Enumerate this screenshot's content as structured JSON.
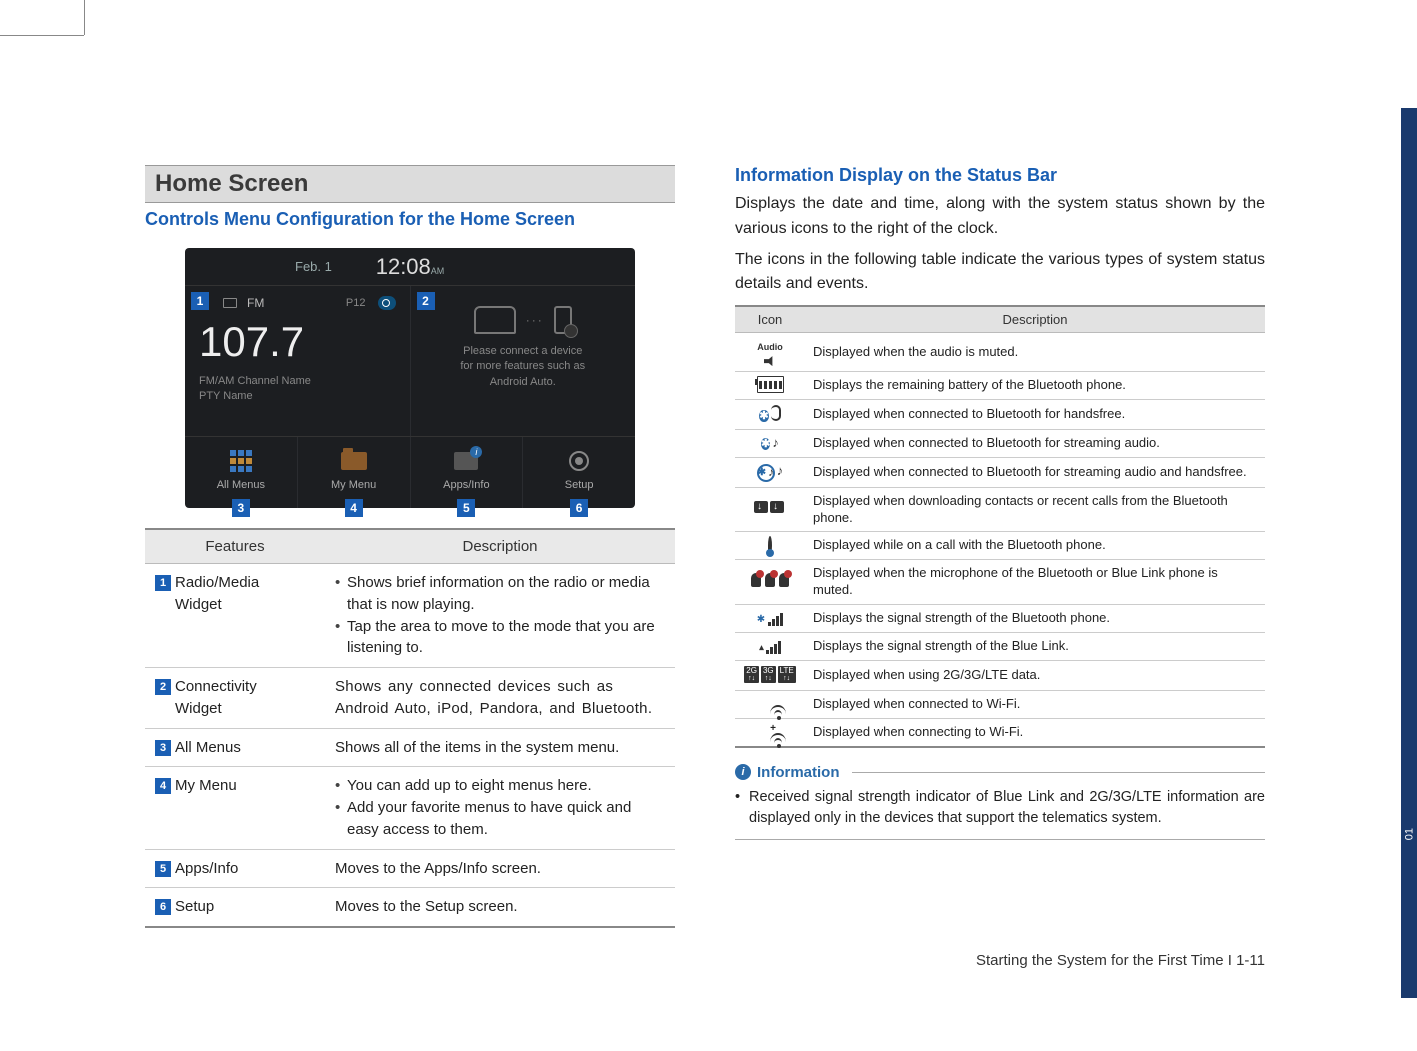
{
  "left": {
    "section_title": "Home Screen",
    "subtitle": "Controls Menu Configuration for the Home Screen",
    "device": {
      "date": "Feb.  1",
      "time": "12:08",
      "ampm": "AM",
      "fm_label": "FM",
      "preset": "P12",
      "frequency": "107.7",
      "channel_line1": "FM/AM Channel Name",
      "channel_line2": "PTY Name",
      "connect_msg_l1": "Please connect a device",
      "connect_msg_l2": "for more features such as",
      "connect_msg_l3": "Android Auto.",
      "btn1": "All Menus",
      "btn2": "My Menu",
      "btn3": "Apps/Info",
      "btn4": "Setup"
    },
    "callouts": {
      "c1": "1",
      "c2": "2",
      "c3": "3",
      "c4": "4",
      "c5": "5",
      "c6": "6"
    },
    "table": {
      "h1": "Features",
      "h2": "Description",
      "rows": [
        {
          "num": "1",
          "name": "Radio/Media Widget",
          "desc_items": [
            "Shows brief information on the radio or media that is now playing.",
            "Tap the area to move to the mode that you are listening to."
          ]
        },
        {
          "num": "2",
          "name": "Connectivity Widget",
          "desc_plain": "Shows any connected devices such as Android Auto, iPod, Pandora, and Bluetooth."
        },
        {
          "num": "3",
          "name": "All Menus",
          "desc_plain": "Shows all of the items in the system menu."
        },
        {
          "num": "4",
          "name": "My Menu",
          "desc_items": [
            "You can add up to eight menus here.",
            "Add your favorite menus to have quick and easy access to them."
          ]
        },
        {
          "num": "5",
          "name": "Apps/Info",
          "desc_plain": "Moves to the Apps/Info screen."
        },
        {
          "num": "6",
          "name": "Setup",
          "desc_plain": "Moves to the Setup screen."
        }
      ]
    }
  },
  "right": {
    "subtitle": "Information Display on the Status Bar",
    "para1": "Displays the date and time, along with the system status shown by the various icons to the right of the clock.",
    "para2": "The icons in the following table indicate the various types of system status details and events.",
    "icon_table": {
      "h1": "Icon",
      "h2": "Description",
      "rows": [
        {
          "icon": "audio-mute",
          "desc": "Displayed when the audio is muted."
        },
        {
          "icon": "battery",
          "desc": "Displays the remaining battery of the Bluetooth phone."
        },
        {
          "icon": "bt-handsfree",
          "desc": "Displayed when connected to Bluetooth for handsfree."
        },
        {
          "icon": "bt-audio",
          "desc": "Displayed when connected to Bluetooth for streaming audio."
        },
        {
          "icon": "bt-both",
          "desc": "Displayed when connected to Bluetooth for streaming audio and handsfree."
        },
        {
          "icon": "bt-download",
          "desc": "Displayed when downloading contacts or recent calls from the Bluetooth phone."
        },
        {
          "icon": "bt-call",
          "desc": "Displayed while on a call with the Bluetooth phone."
        },
        {
          "icon": "mic-mute",
          "desc": "Displayed when the microphone of the Bluetooth or Blue Link phone is muted."
        },
        {
          "icon": "bt-signal",
          "desc": "Displays the signal strength of the Bluetooth phone."
        },
        {
          "icon": "bl-signal",
          "desc": "Displays the signal strength of the Blue Link."
        },
        {
          "icon": "data",
          "desc": "Displayed when using 2G/3G/LTE data."
        },
        {
          "icon": "wifi-on",
          "desc": "Displayed when connected to Wi-Fi."
        },
        {
          "icon": "wifi-conn",
          "desc": "Displayed when connecting to Wi-Fi."
        }
      ]
    },
    "info": {
      "label": "Information",
      "bullet": "Received signal strength indicator of Blue Link and 2G/3G/LTE  information are displayed only in the devices that support the telematics system."
    }
  },
  "footer": "Starting the System for the First Time I 1-11",
  "side_num": "01"
}
